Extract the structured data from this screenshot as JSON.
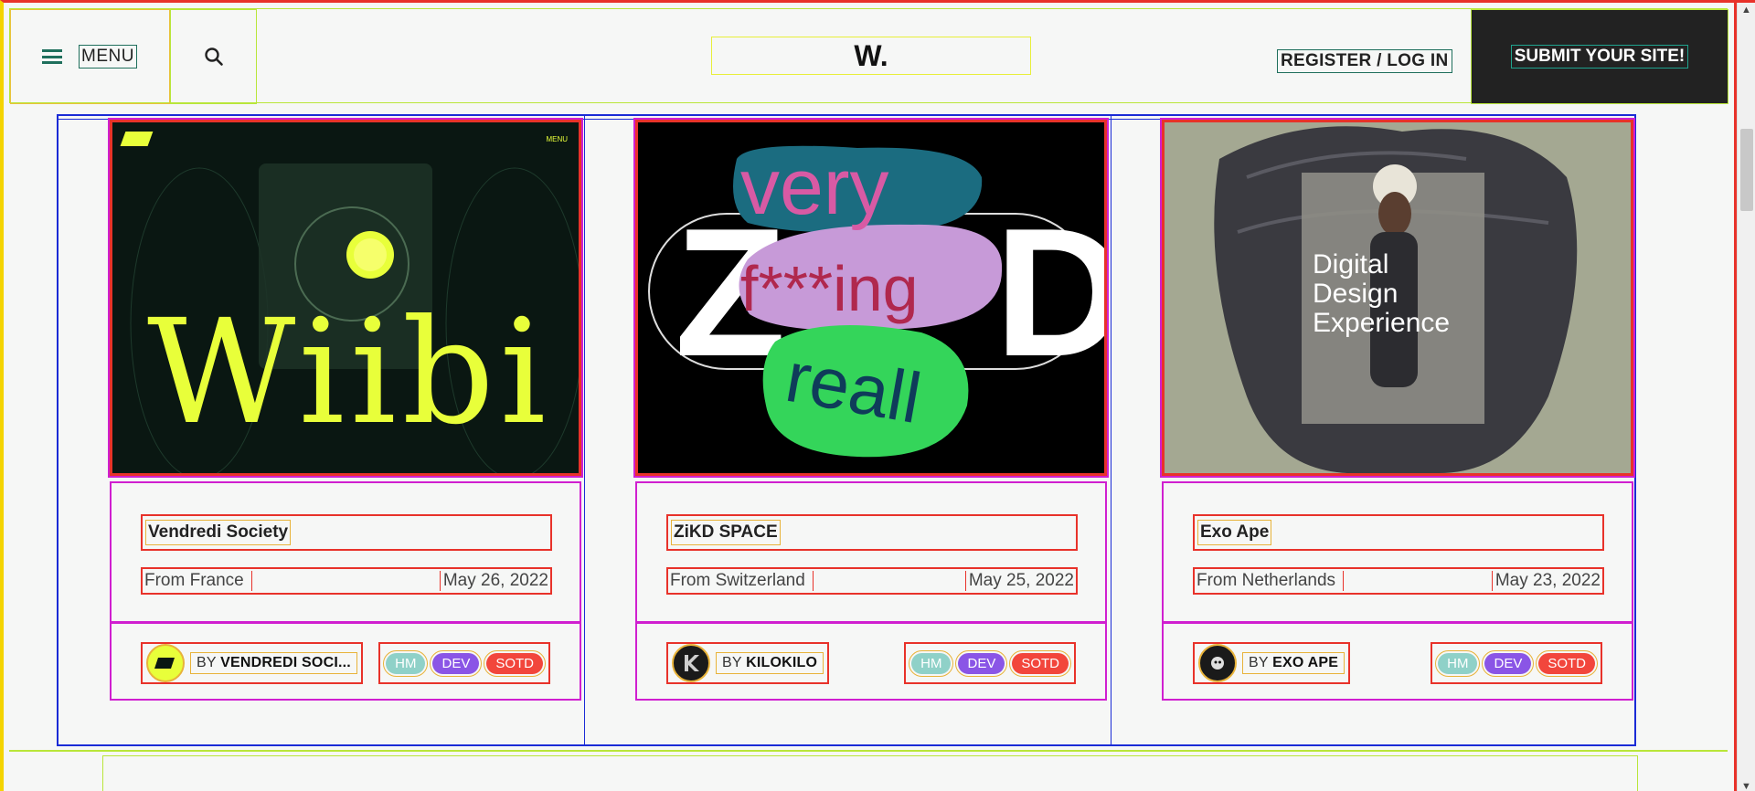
{
  "header": {
    "menu_label": "MENU",
    "logo": "W.",
    "register_label": "REGISTER / LOG IN",
    "submit_label": "SUBMIT YOUR SITE!"
  },
  "cards": [
    {
      "title": "Vendredi Society",
      "country": "From France",
      "date": "May 26, 2022",
      "by_prefix": "BY",
      "author": "VENDREDI SOCI...",
      "tags": [
        "HM",
        "DEV",
        "SOTD"
      ],
      "thumb_text": "Wiibi",
      "thumb_menu": "MENU"
    },
    {
      "title": "ZiKD SPACE",
      "country": "From Switzerland",
      "date": "May 25, 2022",
      "by_prefix": "BY",
      "author": "KILOKILO",
      "tags": [
        "HM",
        "DEV",
        "SOTD"
      ],
      "thumb_text_1": "very",
      "thumb_text_2": "f***ing",
      "thumb_text_3": "reall"
    },
    {
      "title": "Exo Ape",
      "country": "From Netherlands",
      "date": "May 23, 2022",
      "by_prefix": "BY",
      "author": "EXO APE",
      "tags": [
        "HM",
        "DEV",
        "SOTD"
      ],
      "thumb_text_1": "Digital",
      "thumb_text_2": "Design",
      "thumb_text_3": "Experience"
    }
  ],
  "colors": {
    "tag_hm": "#8fd1c8",
    "tag_dev": "#8a55e6",
    "tag_sotd": "#f2463c",
    "submit_bg": "#222222"
  }
}
